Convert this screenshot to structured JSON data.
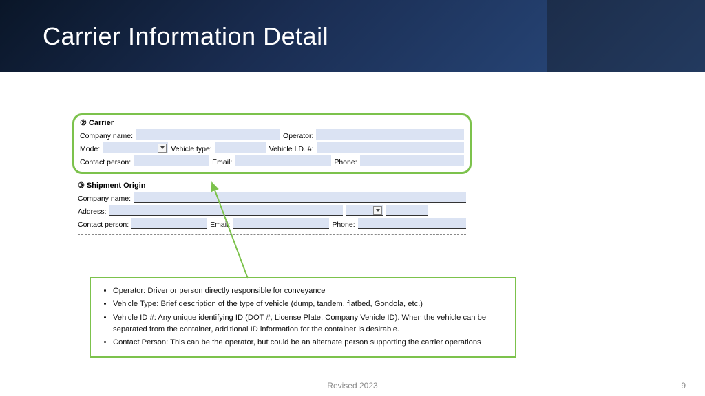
{
  "header": {
    "title": "Carrier Information Detail"
  },
  "carrier": {
    "section_label": "② Carrier",
    "company_name_label": "Company name:",
    "operator_label": "Operator:",
    "mode_label": "Mode:",
    "vehicle_type_label": "Vehicle type:",
    "vehicle_id_label": "Vehicle I.D. #:",
    "contact_label": "Contact  person:",
    "email_label": "Email:",
    "phone_label": "Phone:"
  },
  "origin": {
    "section_label": "③ Shipment Origin",
    "company_name_label": "Company name:",
    "address_label": "Address:",
    "contact_label": "Contact  person:",
    "email_label": "Email:",
    "phone_label": "Phone:"
  },
  "notes": {
    "items": [
      "Operator: Driver or person directly responsible for conveyance",
      "Vehicle Type: Brief description of the type of vehicle (dump, tandem, flatbed, Gondola, etc.)",
      "Vehicle ID #: Any unique identifying ID (DOT #, License Plate, Company Vehicle ID). When the vehicle can be separated from the container, additional ID information for the container is desirable.",
      "Contact Person: This can be the operator, but could be an alternate person supporting the carrier operations"
    ]
  },
  "footer": {
    "revised": "Revised 2023",
    "page": "9"
  },
  "colors": {
    "accent": "#7cc24c",
    "field_fill": "#dbe3f3"
  }
}
